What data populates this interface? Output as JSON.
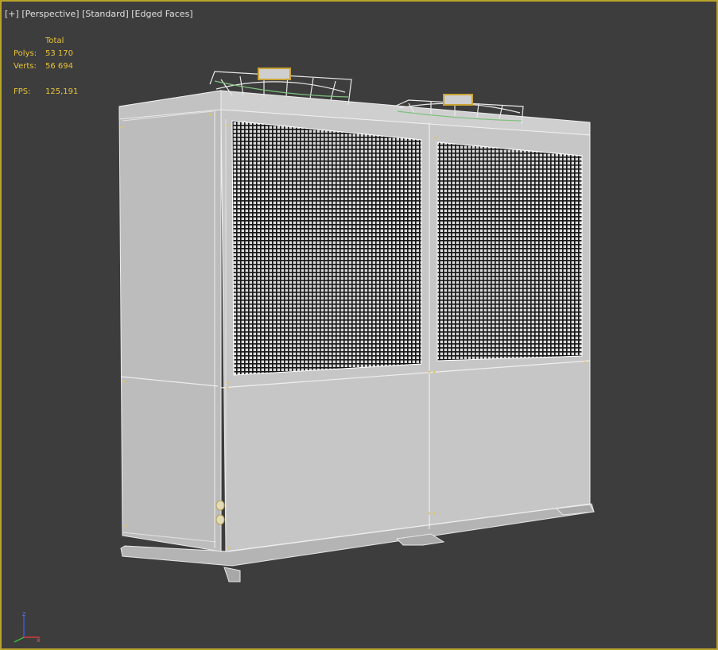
{
  "viewport": {
    "labels": {
      "plus": "[+]",
      "view": "[Perspective]",
      "shading": "[Standard]",
      "mode": "[Edged Faces]"
    },
    "stats": {
      "header": "Total",
      "polys_label": "Polys:",
      "polys_value": "53 170",
      "verts_label": "Verts:",
      "verts_value": "56 694",
      "fps_label": "FPS:",
      "fps_value": "125,191"
    },
    "gizmo_axes": {
      "z": "z",
      "x": "x"
    }
  },
  "colors": {
    "background": "#3d3d3d",
    "active_border": "#b8a32a",
    "stats_text": "#e8c43a",
    "model_face": "#c4c4c4",
    "model_edge": "#eeeeee",
    "grille": "#141414"
  }
}
